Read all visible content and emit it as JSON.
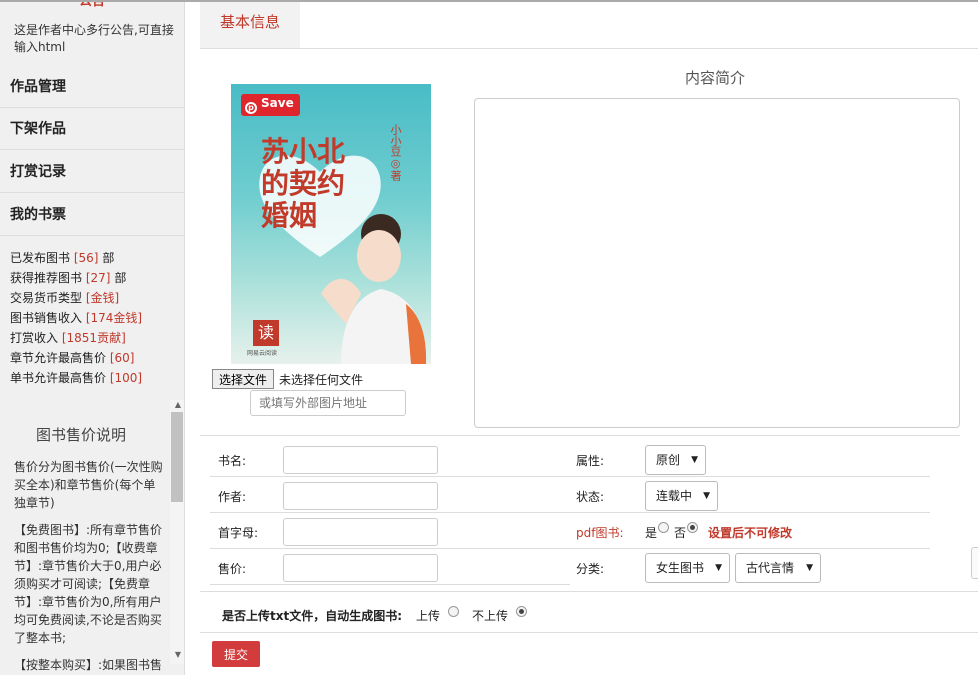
{
  "sidebar": {
    "notice_title": "公告",
    "notice_text": "这是作者中心多行公告,可直接输入html",
    "menu": [
      {
        "label": "作品管理"
      },
      {
        "label": "下架作品"
      },
      {
        "label": "打赏记录"
      },
      {
        "label": "我的书票"
      }
    ],
    "stats": [
      {
        "label": "已发布图书",
        "value": "[56]",
        "suffix": "部"
      },
      {
        "label": "获得推荐图书",
        "value": "[27]",
        "suffix": "部"
      },
      {
        "label": "交易货币类型",
        "value": "[金钱]",
        "suffix": ""
      },
      {
        "label": "图书销售收入",
        "value": "[174金钱]",
        "suffix": ""
      },
      {
        "label": "打赏收入",
        "value": "[1851贡献]",
        "suffix": ""
      },
      {
        "label": "章节允许最高售价",
        "value": "[60]",
        "suffix": ""
      },
      {
        "label": "单书允许最高售价",
        "value": "[100]",
        "suffix": ""
      }
    ],
    "price_title": "图书售价说明",
    "price_paragraphs": [
      "售价分为图书售价(一次性购买全本)和章节售价(每个单独章节)",
      "【免费图书】:所有章节售价和图书售价均为0;【收费章节】:章节售价大于0,用户必须购买才可阅读;【免费章节】:章节售价为0,所有用户均可免费阅读,不论是否购买了整本书;",
      "【按整本购买】:如果图书售"
    ]
  },
  "tabs": [
    {
      "label": "基本信息"
    }
  ],
  "cover": {
    "save_label": "Save",
    "title": "苏小北的契约婚姻",
    "author": "小小豆◎著",
    "stamp": "读",
    "stamp_sub": "网易云阅读"
  },
  "file_upload": {
    "button_label": "选择文件",
    "status": "未选择任何文件",
    "url_placeholder": "或填写外部图片地址"
  },
  "intro": {
    "label": "内容简介",
    "value": ""
  },
  "form": {
    "book_name_label": "书名:",
    "author_label": "作者:",
    "initial_label": "首字母:",
    "price_label": "售价:",
    "attribute_label": "属性:",
    "attribute_value": "原创",
    "status_label": "状态:",
    "status_value": "连载中",
    "pdf_label": "pdf图书:",
    "pdf_yes": "是",
    "pdf_no": "否",
    "pdf_selected": "否",
    "pdf_warning": "设置后不可修改",
    "category_label": "分类:",
    "category_value": "女生图书",
    "subcategory_value": "古代言情",
    "txt_question": "是否上传txt文件，自动生成图书:",
    "txt_upload": "上传",
    "txt_no_upload": "不上传",
    "txt_selected": "不上传",
    "submit_label": "提交"
  },
  "colors": {
    "accent": "#c0392b",
    "submit": "#d23c3c"
  }
}
